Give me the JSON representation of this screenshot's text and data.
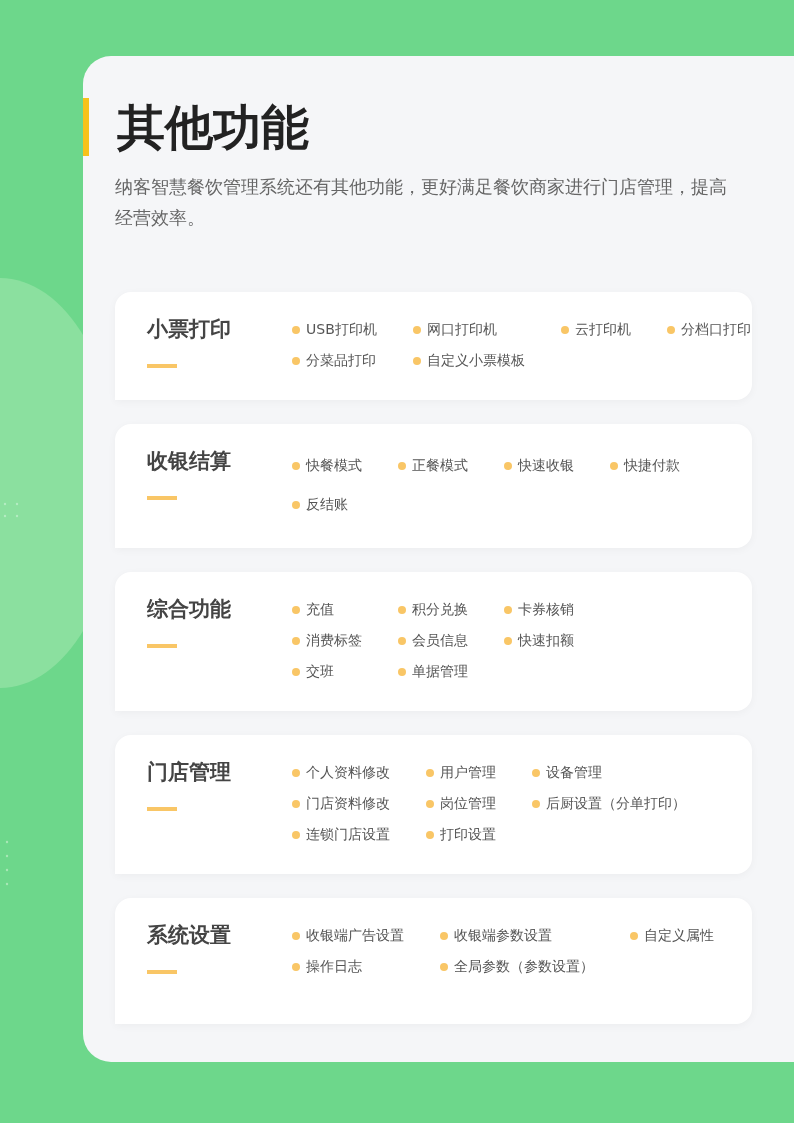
{
  "title": "其他功能",
  "subtitle": "纳客智慧餐饮管理系统还有其他功能，更好满足餐饮商家进行门店管理，提高经营效率。",
  "sections": [
    {
      "name": "小票打印",
      "rows": [
        [
          "USB打印机",
          "网口打印机",
          "云打印机",
          "分档口打印"
        ],
        [
          "分菜品打印",
          "自定义小票模板"
        ]
      ]
    },
    {
      "name": "收银结算",
      "rows": [
        [
          "快餐模式",
          "正餐模式",
          "快速收银",
          "快捷付款"
        ],
        [
          "反结账"
        ]
      ]
    },
    {
      "name": "综合功能",
      "rows": [
        [
          "充值",
          "积分兑换",
          "卡券核销"
        ],
        [
          "消费标签",
          "会员信息",
          "快速扣额"
        ],
        [
          "交班",
          "单据管理"
        ]
      ]
    },
    {
      "name": "门店管理",
      "rows": [
        [
          "个人资料修改",
          "用户管理",
          "设备管理"
        ],
        [
          "门店资料修改",
          "岗位管理",
          "后厨设置（分单打印）"
        ],
        [
          "连锁门店设置",
          "打印设置"
        ]
      ]
    },
    {
      "name": "系统设置",
      "rows": [
        [
          "收银端广告设置",
          "收银端参数设置",
          "自定义属性"
        ],
        [
          "操作日志",
          "全局参数（参数设置）"
        ]
      ]
    }
  ]
}
